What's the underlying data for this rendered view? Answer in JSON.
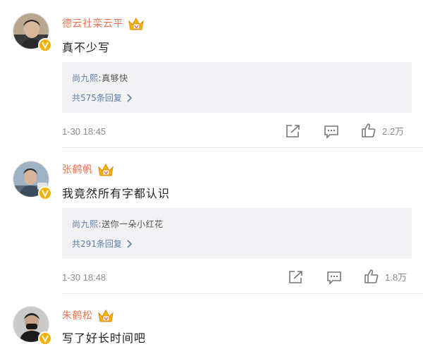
{
  "comments": [
    {
      "username": "德云社栾云平",
      "text": "真不少写",
      "reply": {
        "author": "尚九熙",
        "separator": ":",
        "text": "真够快",
        "count_label": "共575条回复"
      },
      "timestamp": "1-30 18:45",
      "likes": "2.2万",
      "avatar_icon": "user-avatar-photo",
      "badge_icon": "verified-v-icon",
      "crown_icon": "crown-vip-icon"
    },
    {
      "username": "张鹤帆",
      "text": "我竟然所有字都认识",
      "reply": {
        "author": "尚九熙",
        "separator": ":",
        "text": "送你一朵小红花",
        "count_label": "共291条回复"
      },
      "timestamp": "1-30 18:48",
      "likes": "1.8万",
      "avatar_icon": "user-avatar-photo",
      "badge_icon": "verified-v-icon",
      "crown_icon": "crown-vip-icon"
    },
    {
      "username": "朱鹤松",
      "text": "写了好长时间吧",
      "avatar_icon": "user-avatar-photo",
      "badge_icon": "verified-v-icon",
      "crown_icon": "crown-vip-icon"
    }
  ],
  "colors": {
    "username": "#eb7350",
    "link": "#5d7ea8",
    "reply_bg": "#f2f2f5",
    "meta": "#8a8a8a",
    "badge": "#f6b100"
  },
  "icons": {
    "share": "share-icon",
    "comment": "comment-icon",
    "like": "thumbs-up-icon",
    "chevron": "chevron-right-icon"
  }
}
